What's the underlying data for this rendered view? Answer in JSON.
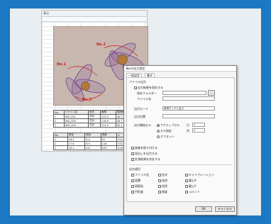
{
  "sheet": {
    "tab_label": "表示"
  },
  "photo_labels": [
    "No.1",
    "No.2",
    "No.3"
  ],
  "table1": {
    "headers": [
      "No.",
      "ファイル名",
      "型式",
      "面積",
      "周囲長",
      "円形度"
    ],
    "rows": [
      [
        "1",
        "IMG_001",
        "花弁",
        "125.4",
        "48.2",
        "0.68"
      ],
      [
        "2",
        "IMG_002",
        "花弁",
        "118.9",
        "46.7",
        "0.69"
      ],
      [
        "3",
        "IMG_003",
        "花弁",
        "131.0",
        "50.1",
        "0.66"
      ]
    ]
  },
  "table2": {
    "headers": [
      "No.",
      "長径",
      "短径",
      "角度",
      "X",
      "Y"
    ],
    "rows": [
      [
        "1",
        "18.2",
        "9.4",
        "32",
        "410",
        "220"
      ],
      [
        "2",
        "17.6",
        "8.9",
        "118",
        "352",
        "301"
      ],
      [
        "3",
        "19.1",
        "9.8",
        "205",
        "418",
        "338"
      ]
    ]
  },
  "dialog": {
    "title": "Excel出力設定",
    "tabs": [
      "一般設定",
      "書式"
    ],
    "group_file": "ファイル出力",
    "cb_save_with_book": "出力結果を保存する",
    "lbl_save_folder": "保存フォルダー",
    "lbl_file_name": "ファイル名",
    "lbl_sheet_mode": "出力モード",
    "sheet_mode_value": "新規ブックに出力",
    "lbl_output_pos": "出力位置",
    "lbl_start": "出力開始セル",
    "radio_active": "アクティブセル",
    "radio_fixed": "セル指定",
    "radio_offset": "オフセット",
    "lbl_row": "行",
    "lbl_col": "列",
    "row_value": "1",
    "col_value": "1",
    "cb_image": "画像を貼り付ける",
    "cb_header": "見出しを出力する",
    "cb_sum": "計測結果を合計する",
    "group_items": "出力項目",
    "items": [
      "ファイル名",
      "型式",
      "面積",
      "周囲長",
      "円形度",
      "長径",
      "短径",
      "角度",
      "重心X",
      "重心Y",
      "キャリブレーション",
      "コメント"
    ],
    "ok": "OK",
    "cancel": "キャンセル"
  }
}
